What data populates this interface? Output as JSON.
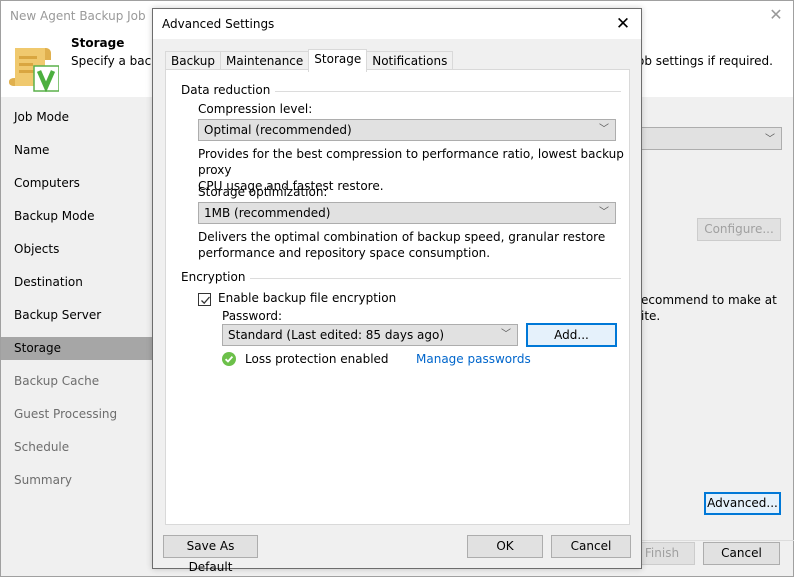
{
  "wizard": {
    "title": "New Agent Backup Job",
    "close_icon": "close-icon",
    "header": {
      "title": "Storage",
      "description_left": "Specify a backu",
      "description_right": "ob settings if required.",
      "icon": "scroll-check-icon"
    },
    "nav": [
      {
        "label": "Job Mode",
        "state": "done"
      },
      {
        "label": "Name",
        "state": "done"
      },
      {
        "label": "Computers",
        "state": "done"
      },
      {
        "label": "Backup Mode",
        "state": "done"
      },
      {
        "label": "Objects",
        "state": "done"
      },
      {
        "label": "Destination",
        "state": "done"
      },
      {
        "label": "Backup Server",
        "state": "done"
      },
      {
        "label": "Storage",
        "state": "active"
      },
      {
        "label": "Backup Cache",
        "state": "todo"
      },
      {
        "label": "Guest Processing",
        "state": "todo"
      },
      {
        "label": "Schedule",
        "state": "todo"
      },
      {
        "label": "Summary",
        "state": "todo"
      }
    ],
    "configure_label": "Configure...",
    "partial_text_line1": "ecommend to make at",
    "partial_text_line2": "ite.",
    "advanced_label": "Advanced...",
    "finish_label": "Finish",
    "cancel_label": "Cancel"
  },
  "dialog": {
    "title": "Advanced Settings",
    "tabs": [
      {
        "label": "Backup",
        "active": false
      },
      {
        "label": "Maintenance",
        "active": false
      },
      {
        "label": "Storage",
        "active": true
      },
      {
        "label": "Notifications",
        "active": false
      }
    ],
    "data_reduction": {
      "group_label": "Data reduction",
      "compression_label": "Compression level:",
      "compression_value": "Optimal (recommended)",
      "compression_desc_1": "Provides for the best compression to performance ratio, lowest backup proxy",
      "compression_desc_2": "CPU usage and fastest restore.",
      "optimization_label": "Storage optimization:",
      "optimization_value": "1MB (recommended)",
      "optimization_desc_1": "Delivers the optimal combination of backup speed, granular restore",
      "optimization_desc_2": "performance and repository space consumption."
    },
    "encryption": {
      "group_label": "Encryption",
      "enable_label": "Enable backup file encryption",
      "enable_checked": true,
      "password_label": "Password:",
      "password_value": "Standard (Last edited: 85 days ago)",
      "add_label": "Add...",
      "status_text": "Loss protection enabled",
      "status_color": "#6cc04a",
      "manage_link": "Manage passwords"
    },
    "save_default_label": "Save As Default",
    "ok_label": "OK",
    "cancel_label": "Cancel"
  }
}
